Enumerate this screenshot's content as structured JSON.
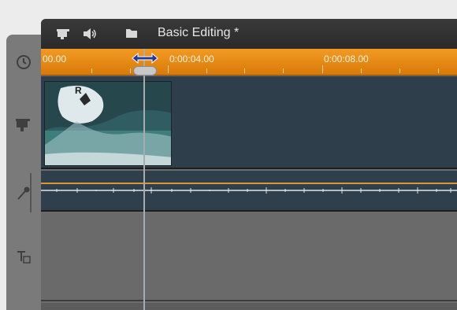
{
  "project": {
    "title": "Basic Editing *"
  },
  "toolbar": {
    "icons": [
      "camera-icon",
      "speaker-icon",
      "folder-icon"
    ]
  },
  "timeline": {
    "timecodes": [
      "00.00",
      "0:00:04.00",
      "0:00:08.00"
    ]
  },
  "clip": {
    "label": "R"
  },
  "rail": {
    "icons": [
      "clock-icon",
      "camera-track-icon",
      "microphone-icon",
      "text-track-icon"
    ]
  },
  "colors": {
    "ruler": "#f29a24",
    "track": "#2e3e4a",
    "header": "#2f2f2f",
    "audio_level": "#e0962e"
  }
}
